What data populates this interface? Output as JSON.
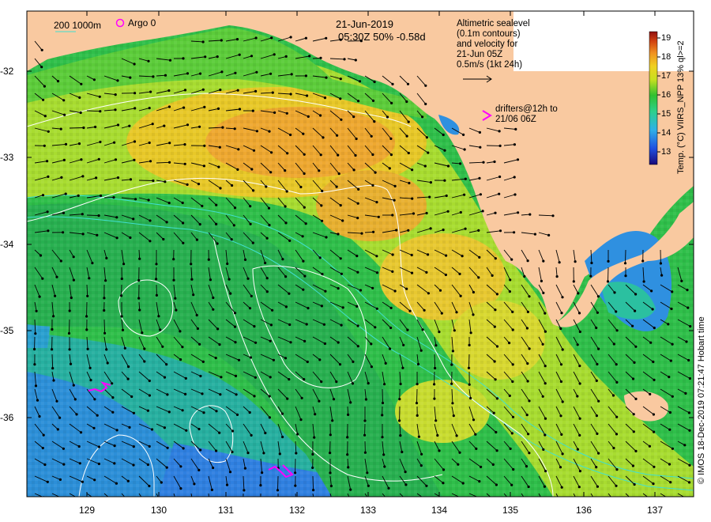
{
  "header": {
    "date": "21-Jun-2019",
    "time_line": "05:30Z  50% -0.58d"
  },
  "legend": {
    "depth_label": "200  1000m",
    "argo_label": "Argo 0",
    "altimetry_lines": [
      "Altimetric sealevel",
      "(0.1m contours)",
      "and velocity for",
      "21-Jun 05Z",
      "0.5m/s (1kt 24h)"
    ],
    "drifters_lines": [
      "drifters@12h to",
      "21/06 06Z"
    ],
    "drifter_symbol": ">"
  },
  "colorbar": {
    "title": "Temp. (°C)  VIIRS_NPP 13% ql>=2",
    "ticks": [
      "13",
      "14",
      "15",
      "16",
      "17",
      "18",
      "19"
    ],
    "vmin": 12.5,
    "vmax": 19.5
  },
  "axes": {
    "x_ticks": [
      "129",
      "130",
      "131",
      "132",
      "133",
      "134",
      "135",
      "136",
      "137"
    ],
    "y_ticks": [
      "-32",
      "-33",
      "-34",
      "-35",
      "-36"
    ]
  },
  "credit": "© IMOS 18-Dec-2019 07:21:47 Hobart time",
  "colors": {
    "land": "#f9c9a0",
    "contour": "#ffffff",
    "isobath": "#40e0d0",
    "argo": "#ff00ff",
    "drifter": "#ff00ff",
    "arrow": "#000000"
  }
}
